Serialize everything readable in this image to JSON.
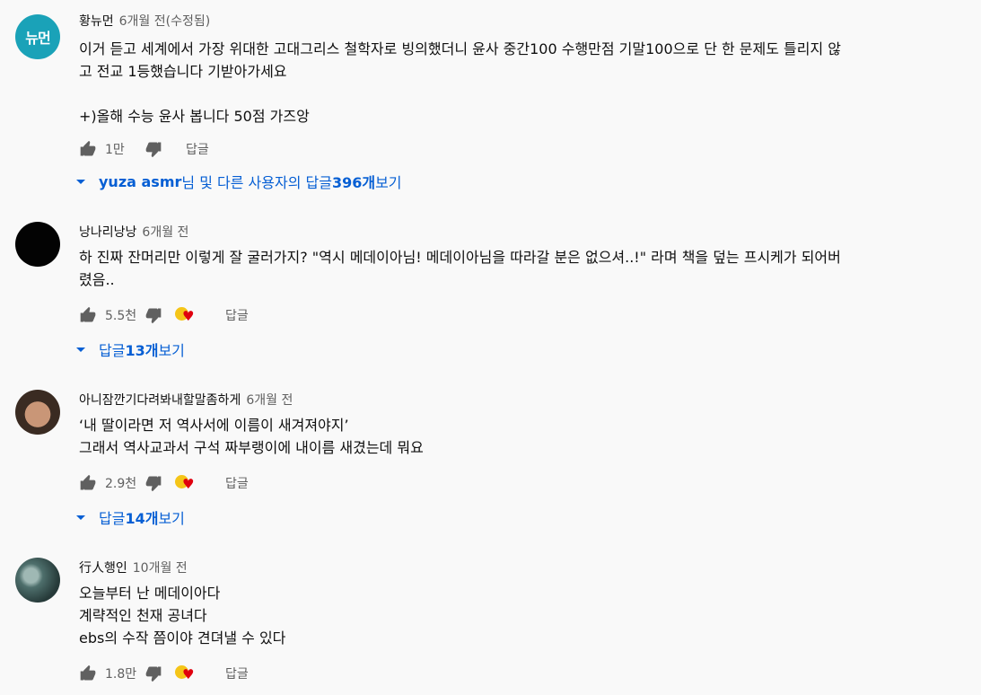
{
  "comments": [
    {
      "author": "황뉴먼",
      "avatar_text": "뉴먼",
      "time": "6개월 전(수정됨)",
      "text": "이거 듣고 세계에서 가장 위대한 고대그리스 철학자로 빙의했더니 윤사 중간100 수행만점 기말100으로 단 한 문제도 틀리지 않\n고 전교 1등했습니다 기받아가세요\n\n+)올해 수능 윤사 봅니다 50점 가즈앙",
      "likes": "1만",
      "reply_label": "답글",
      "replies_author": "yuza asmr",
      "replies_mid": "님 및 다른 사용자의 답글 ",
      "replies_count": "396개",
      "replies_tail": " 보기"
    },
    {
      "author": "낭나리낭낭",
      "time": "6개월 전",
      "text": "하 진짜 잔머리만 이렇게 잘 굴러가지? \"역시 메데이아님! 메데이아님을 따라갈 분은 없으셔..!\" 라며 책을 덮는 프시케가 되어버\n렸음..",
      "likes": "5.5천",
      "reply_label": "답글",
      "replies_pre": "답글 ",
      "replies_count": "13개",
      "replies_tail": " 보기"
    },
    {
      "author": "아니잠깐기다려봐내할말좀하게",
      "time": "6개월 전",
      "text": "‘내 딸이라면 저 역사서에 이름이 새겨져야지’\n그래서 역사교과서 구석 짜부랭이에 내이름 새겼는데 뭐요",
      "likes": "2.9천",
      "reply_label": "답글",
      "replies_pre": "답글 ",
      "replies_count": "14개",
      "replies_tail": " 보기"
    },
    {
      "author": "行人행인",
      "time": "10개월 전",
      "text": "오늘부터 난 메데이아다\n계략적인 천재 공녀다\nebs의 수작 쯤이야 견뎌낼 수 있다",
      "likes": "1.8만",
      "reply_label": "답글"
    }
  ],
  "icons": {
    "like": "thumb-up-icon",
    "dislike": "thumb-down-icon",
    "creator_heart": "creator-heart-icon",
    "expand": "caret-down-icon"
  },
  "colors": {
    "background": "#f9f9f9",
    "link": "#065fd4",
    "muted": "#606060",
    "heart": "#e0000e"
  }
}
